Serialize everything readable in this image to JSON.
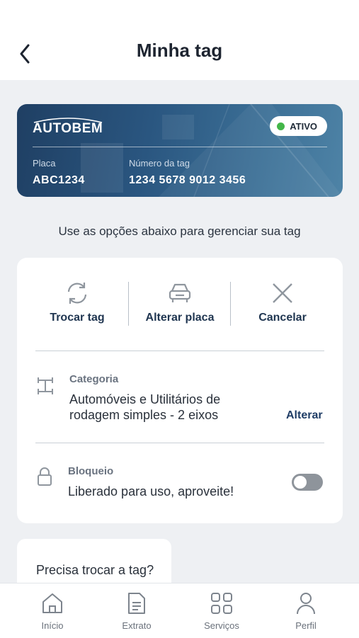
{
  "header": {
    "title": "Minha tag",
    "back_icon": "chevron-left-icon"
  },
  "tag_card": {
    "brand": "AUTOBEM",
    "status": "ATIVO",
    "status_color": "#43b649",
    "plate_label": "Placa",
    "plate_value": "ABC1234",
    "tag_number_label": "Número da tag",
    "tag_number_value": "1234 5678 9012 3456"
  },
  "subtitle": "Use as opções abaixo para gerenciar sua tag",
  "actions": [
    {
      "label": "Trocar tag",
      "icon": "refresh-icon"
    },
    {
      "label": "Alterar placa",
      "icon": "car-icon"
    },
    {
      "label": "Cancelar",
      "icon": "close-icon"
    }
  ],
  "category": {
    "title": "Categoria",
    "text": "Automóveis e Utilitários de rodagem simples - 2 eixos",
    "action": "Alterar",
    "icon": "axle-icon"
  },
  "block": {
    "title": "Bloqueio",
    "text": "Liberado para uso, aproveite!",
    "icon": "lock-icon",
    "toggle_on": false
  },
  "help_card": {
    "text": "Precisa trocar a tag?"
  },
  "bottom_nav": [
    {
      "label": "Início",
      "icon": "home-icon"
    },
    {
      "label": "Extrato",
      "icon": "document-icon"
    },
    {
      "label": "Serviços",
      "icon": "grid-icon"
    },
    {
      "label": "Perfil",
      "icon": "user-icon"
    }
  ]
}
